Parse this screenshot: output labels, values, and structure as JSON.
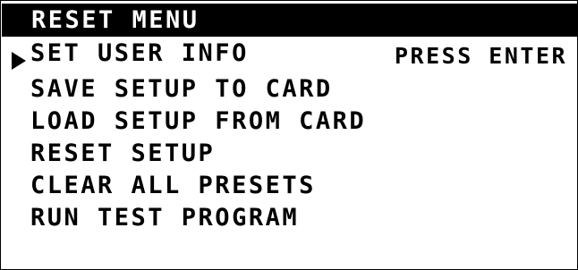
{
  "menu": {
    "title": "RESET MENU",
    "hint": "PRESS ENTER",
    "selected_index": 0,
    "items": [
      {
        "label": "SET USER INFO"
      },
      {
        "label": "SAVE SETUP TO CARD"
      },
      {
        "label": "LOAD SETUP FROM CARD"
      },
      {
        "label": "RESET SETUP"
      },
      {
        "label": "CLEAR ALL PRESETS"
      },
      {
        "label": "RUN TEST PROGRAM"
      }
    ]
  },
  "colors": {
    "foreground": "#000000",
    "background": "#ffffff",
    "title_text": "#ffffff",
    "title_bar": "#000000"
  }
}
